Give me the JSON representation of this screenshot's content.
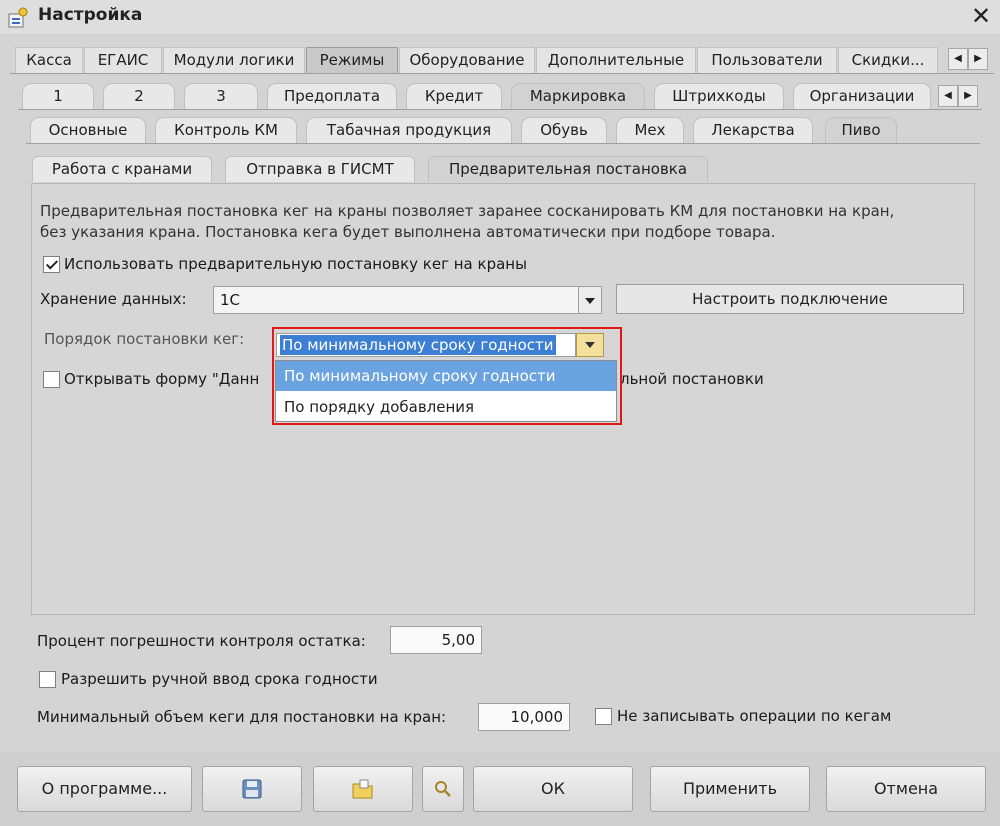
{
  "window": {
    "title": "Настройка",
    "close_symbol": "✕"
  },
  "tabs_row1": [
    "Касса",
    "ЕГАИС",
    "Модули логики",
    "Режимы",
    "Оборудование",
    "Дополнительные",
    "Пользователи",
    "Скидки..."
  ],
  "tabs_row2": [
    "1",
    "2",
    "3",
    "Предоплата",
    "Кредит",
    "Маркировка",
    "Штрихкоды",
    "Организации"
  ],
  "tabs_row3": [
    "Основные",
    "Контроль КМ",
    "Табачная продукция",
    "Обувь",
    "Мех",
    "Лекарства",
    "Пиво"
  ],
  "tabs_row4": [
    "Работа с кранами",
    "Отправка в ГИСМТ",
    "Предварительная постановка"
  ],
  "scroll_arrows": {
    "left": "◀",
    "right": "▶"
  },
  "panel": {
    "desc_line1": "Предварительная постановка кег на краны позволяет заранее сосканировать КМ для постановки на кран,",
    "desc_line2": "без указания крана. Постановка кега будет выполнена автоматически при подборе товара.",
    "use_precheck_label": "Использовать предварительную постановку кег на краны",
    "use_precheck_checked": true,
    "storage_label": "Хранение данных:",
    "storage_value": "1С",
    "configure_button": "Настроить подключение",
    "order_label": "Порядок постановки кег:",
    "order_value": "По минимальному сроку годности",
    "order_options": [
      "По минимальному сроку годности",
      "По порядку добавления"
    ],
    "open_form_label_start": "Открывать форму \"Данн",
    "open_form_label_end": "льной постановки",
    "open_form_checked": false
  },
  "percent_label": "Процент погрешности контроля остатка:",
  "percent_value": "5,00",
  "manual_expiry_label": "Разрешить ручной ввод срока годности",
  "manual_expiry_checked": false,
  "min_volume_label": "Минимальный объем кеги для постановки на кран:",
  "min_volume_value": "10,000",
  "no_keg_ops_label": "Не записывать операции по кегам",
  "no_keg_ops_checked": false,
  "buttons": {
    "about": "О программе...",
    "ok": "ОК",
    "apply": "Применить",
    "cancel": "Отмена"
  }
}
